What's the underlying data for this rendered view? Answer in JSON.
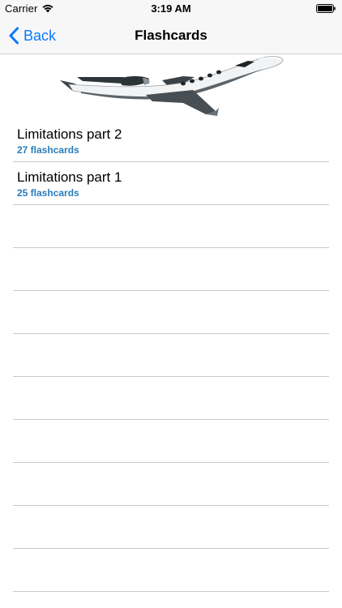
{
  "status_bar": {
    "carrier": "Carrier",
    "time": "3:19 AM"
  },
  "nav": {
    "back_label": "Back",
    "title": "Flashcards"
  },
  "colors": {
    "accent": "#0a7aff",
    "subtitle": "#2a7dbb",
    "separator": "#c8c7cc",
    "bar_background": "#f7f7f7"
  },
  "hero_image": "business-jet-icon",
  "decks": [
    {
      "title": "Limitations part 2",
      "count": "27 flashcards"
    },
    {
      "title": "Limitations part 1",
      "count": "25 flashcards"
    }
  ]
}
